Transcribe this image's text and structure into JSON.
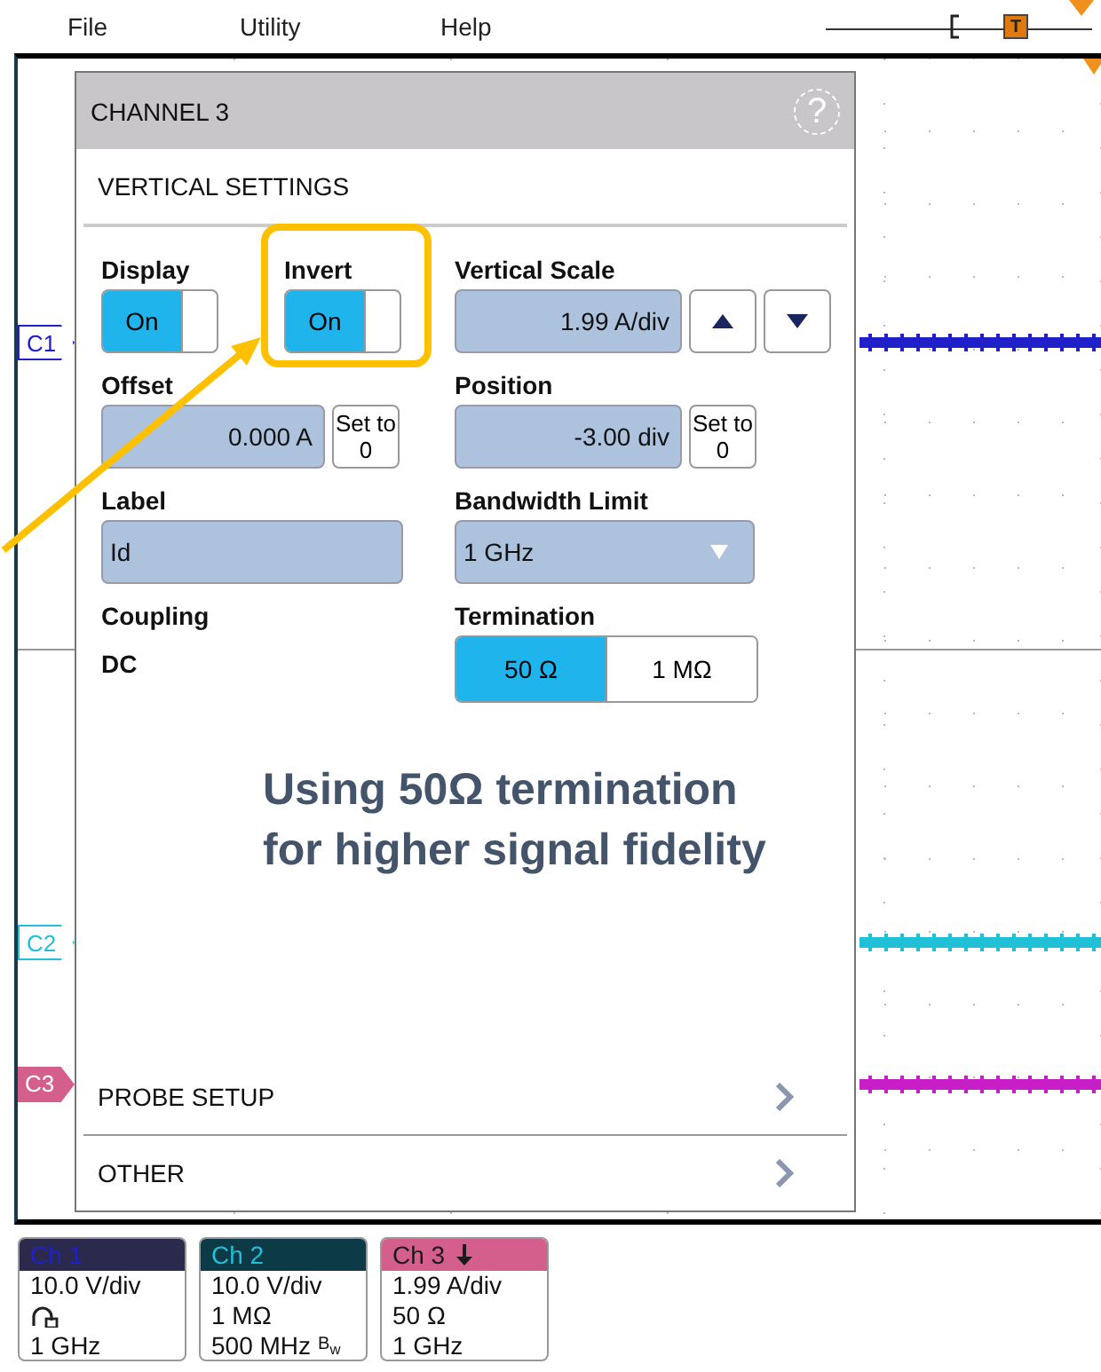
{
  "menu": [
    {
      "label": "File"
    },
    {
      "label": "Utility"
    },
    {
      "label": "Help"
    }
  ],
  "trigger": {
    "marker": "T"
  },
  "graticule": {
    "channels": [
      {
        "marker": "C1",
        "color": "#2020c8",
        "selected": false
      },
      {
        "marker": "C2",
        "color": "#20c0d8",
        "selected": false
      },
      {
        "marker": "C3",
        "color": "#c81ec8",
        "selected": true
      }
    ]
  },
  "dialog": {
    "title": "CHANNEL 3",
    "help": "?",
    "section": "VERTICAL SETTINGS",
    "display": {
      "label": "Display",
      "value": "On",
      "on": true
    },
    "invert": {
      "label": "Invert",
      "value": "On",
      "on": true
    },
    "vertical_scale": {
      "label": "Vertical Scale",
      "value": "1.99 A/div"
    },
    "offset": {
      "label": "Offset",
      "value": "0.000 A",
      "reset": "Set to 0"
    },
    "position": {
      "label": "Position",
      "value": "-3.00 div",
      "reset": "Set to 0"
    },
    "label_field": {
      "label": "Label",
      "value": "Id"
    },
    "bandwidth_limit": {
      "label": "Bandwidth Limit",
      "value": "1 GHz"
    },
    "coupling": {
      "label": "Coupling",
      "value": "DC"
    },
    "termination": {
      "label": "Termination",
      "options": [
        {
          "label": "50 Ω",
          "selected": true
        },
        {
          "label": "1 MΩ",
          "selected": false
        }
      ]
    },
    "sections": [
      {
        "label": "PROBE SETUP"
      },
      {
        "label": "OTHER"
      }
    ]
  },
  "callout": {
    "lines": [
      "Using 50Ω termination",
      "for higher signal fidelity"
    ]
  },
  "badges": [
    {
      "title": "Ch 1",
      "color": "#2b2a4c",
      "inverted": false,
      "lines": [
        {
          "kind": "text",
          "text": "10.0 V/div"
        },
        {
          "kind": "probe"
        },
        {
          "kind": "text",
          "text": "1 GHz"
        }
      ]
    },
    {
      "title": "Ch 2",
      "color": "#0c3a47",
      "inverted": false,
      "lines": [
        {
          "kind": "text",
          "text": "10.0 V/div"
        },
        {
          "kind": "text",
          "text": "1 MΩ"
        },
        {
          "kind": "text",
          "text": "500 MHz",
          "mark": "B$_{w}$"
        }
      ]
    },
    {
      "title": "Ch 3",
      "color": "#d45f8c",
      "inverted": true,
      "lines": [
        {
          "kind": "text",
          "text": "1.99 A/div"
        },
        {
          "kind": "text",
          "text": "50 Ω"
        },
        {
          "kind": "text",
          "text": "1 GHz"
        }
      ]
    }
  ]
}
